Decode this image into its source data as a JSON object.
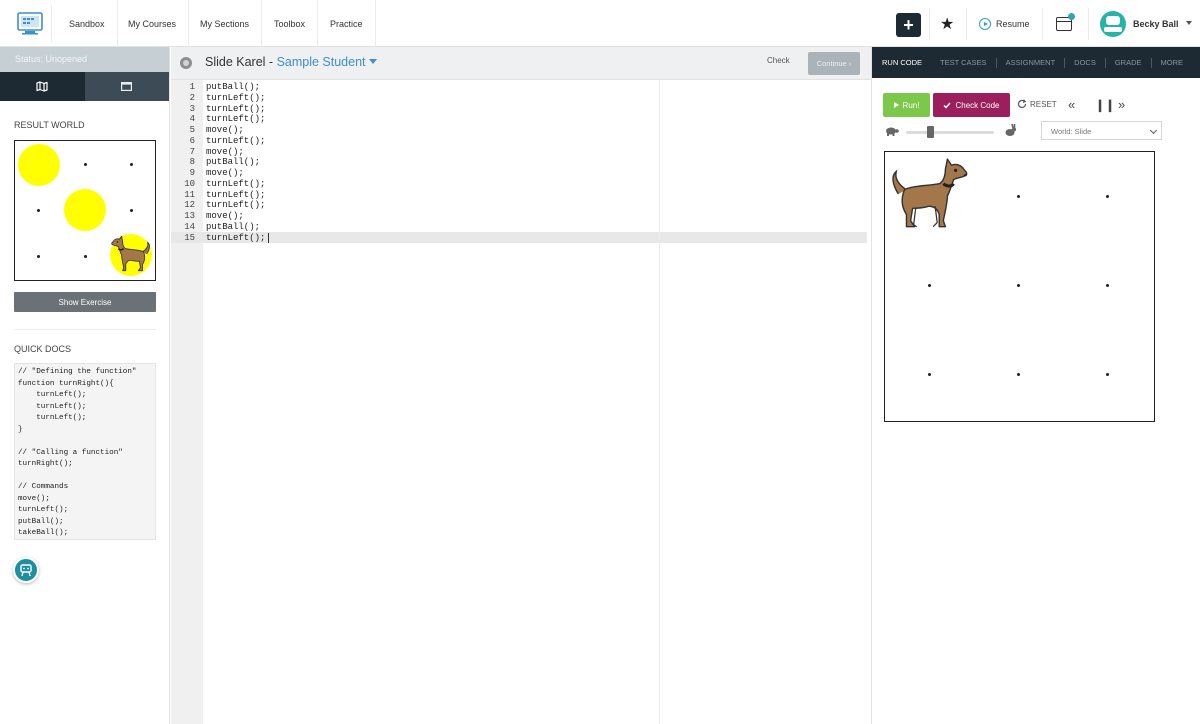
{
  "nav": {
    "links": [
      "Sandbox",
      "My Courses",
      "My Sections",
      "Toolbox",
      "Practice"
    ],
    "plus": "+",
    "resume": "Resume",
    "user": "Becky Ball"
  },
  "left": {
    "status": "Status: Unopened",
    "result_world_label": "RESULT WORLD",
    "show_exercise": "Show Exercise",
    "quick_docs_label": "QUICK DOCS",
    "docs_lines": [
      "// \"Defining the function\"",
      "function turnRight(){",
      "    turnLeft();",
      "    turnLeft();",
      "    turnLeft();",
      "}",
      "",
      "// \"Calling a function\"",
      "turnRight();",
      "",
      "// Commands",
      "move();",
      "turnLeft();",
      "putBall();",
      "takeBall();"
    ]
  },
  "editor": {
    "title": "Slide Karel - ",
    "student": "Sample Student",
    "check": "Check",
    "continue": "Continue ›",
    "lines": [
      "putBall();",
      "turnLeft();",
      "turnLeft();",
      "turnLeft();",
      "move();",
      "turnLeft();",
      "move();",
      "putBall();",
      "move();",
      "turnLeft();",
      "turnLeft();",
      "turnLeft();",
      "move();",
      "putBall();",
      "turnLeft();"
    ],
    "active_line": 15
  },
  "right": {
    "tabs": [
      "RUN CODE",
      "TEST CASES",
      "ASSIGNMENT",
      "DOCS",
      "GRADE",
      "MORE"
    ],
    "run": "Run!",
    "check_code": "Check Code",
    "reset": "RESET",
    "world_select": "World: Slide",
    "speed": 0.3
  },
  "colors": {
    "nav_dark": "#1e2a33",
    "run_green": "#7cc84a",
    "check_magenta": "#9a1f5c",
    "ball_yellow": "#ffff00",
    "link_blue": "#3c8fd0",
    "teal": "#2fa4b8"
  }
}
